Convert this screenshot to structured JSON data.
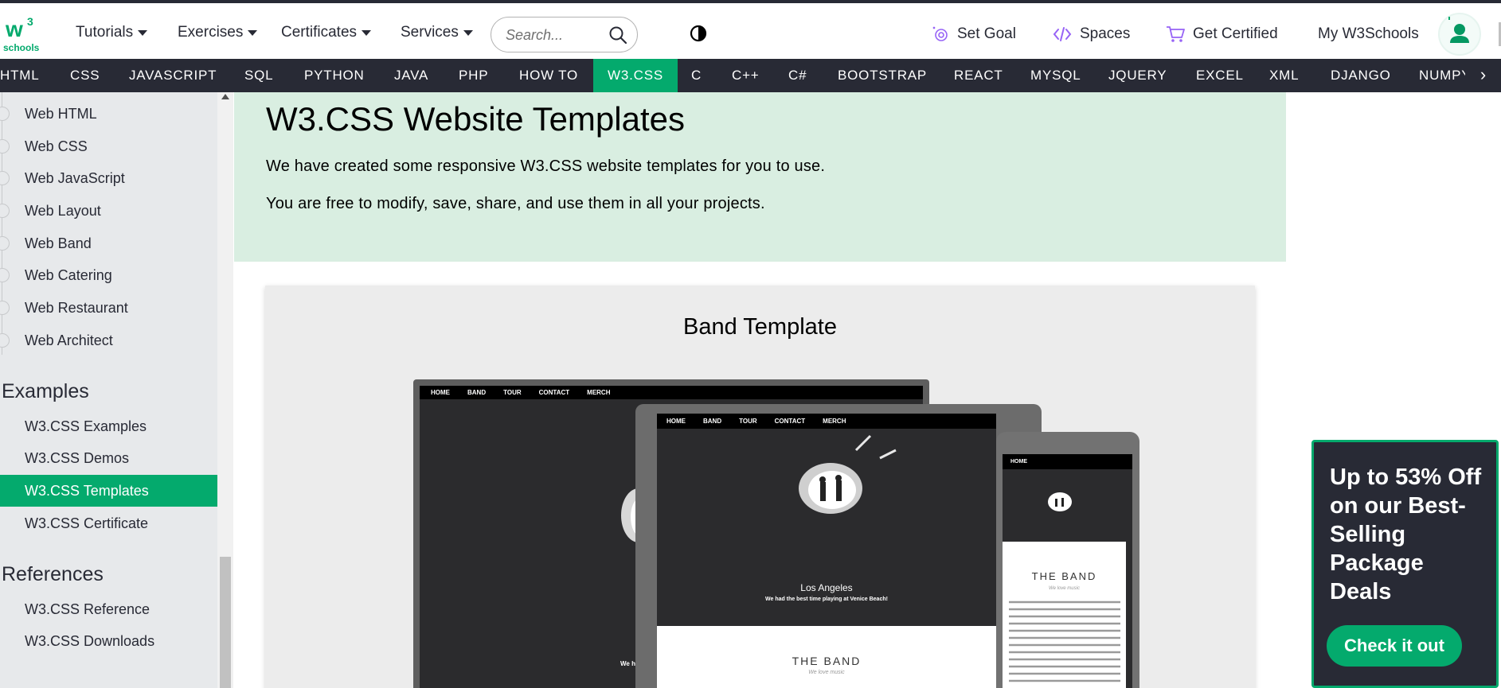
{
  "header": {
    "logo_text": "w3 schools",
    "menus": [
      "Tutorials",
      "Exercises",
      "Certificates",
      "Services"
    ],
    "search": {
      "placeholder": "Search...",
      "value": ""
    },
    "right_links": [
      "Set Goal",
      "Spaces",
      "Get Certified",
      "My W3Schools"
    ],
    "colors": {
      "brand_green": "#04aa6d",
      "dark": "#282a35",
      "accent_purple": "#9763f6"
    }
  },
  "langnav": {
    "items": [
      "HTML",
      "CSS",
      "JAVASCRIPT",
      "SQL",
      "PYTHON",
      "JAVA",
      "PHP",
      "HOW TO",
      "W3.CSS",
      "C",
      "C++",
      "C#",
      "BOOTSTRAP",
      "REACT",
      "MYSQL",
      "JQUERY",
      "EXCEL",
      "XML",
      "DJANGO",
      "NUMPY"
    ],
    "active": "W3.CSS",
    "next_icon": "chevron-right-icon"
  },
  "sidebar": {
    "templates": [
      "Web HTML",
      "Web CSS",
      "Web JavaScript",
      "Web Layout",
      "Web Band",
      "Web Catering",
      "Web Restaurant",
      "Web Architect"
    ],
    "examples_heading": "Examples",
    "examples": [
      "W3.CSS Examples",
      "W3.CSS Demos",
      "W3.CSS Templates",
      "W3.CSS Certificate"
    ],
    "examples_active": "W3.CSS Templates",
    "references_heading": "References",
    "references": [
      "W3.CSS Reference",
      "W3.CSS Downloads"
    ]
  },
  "main": {
    "title": "W3.CSS Website Templates",
    "intro1": "We have created some responsive W3.CSS website templates for you to use.",
    "intro2": "You are free to modify, save, share, and use them in all your projects.",
    "card_title": "Band Template",
    "mockup": {
      "laptop_nav": [
        "HOME",
        "BAND",
        "TOUR",
        "CONTACT",
        "MERCH"
      ],
      "tablet_nav": [
        "HOME",
        "BAND",
        "TOUR",
        "CONTACT",
        "MERCH"
      ],
      "phone_nav": [
        "HOME"
      ],
      "city": "Los Angeles",
      "caption": "We had the best time playing at Venice Beach!",
      "band_heading": "THE BAND",
      "band_sub": "We love music",
      "laptop_caption": "We had th"
    }
  },
  "ad": {
    "text": "Up to 53% Off on our Best-Selling Package Deals",
    "button": "Check it out"
  }
}
